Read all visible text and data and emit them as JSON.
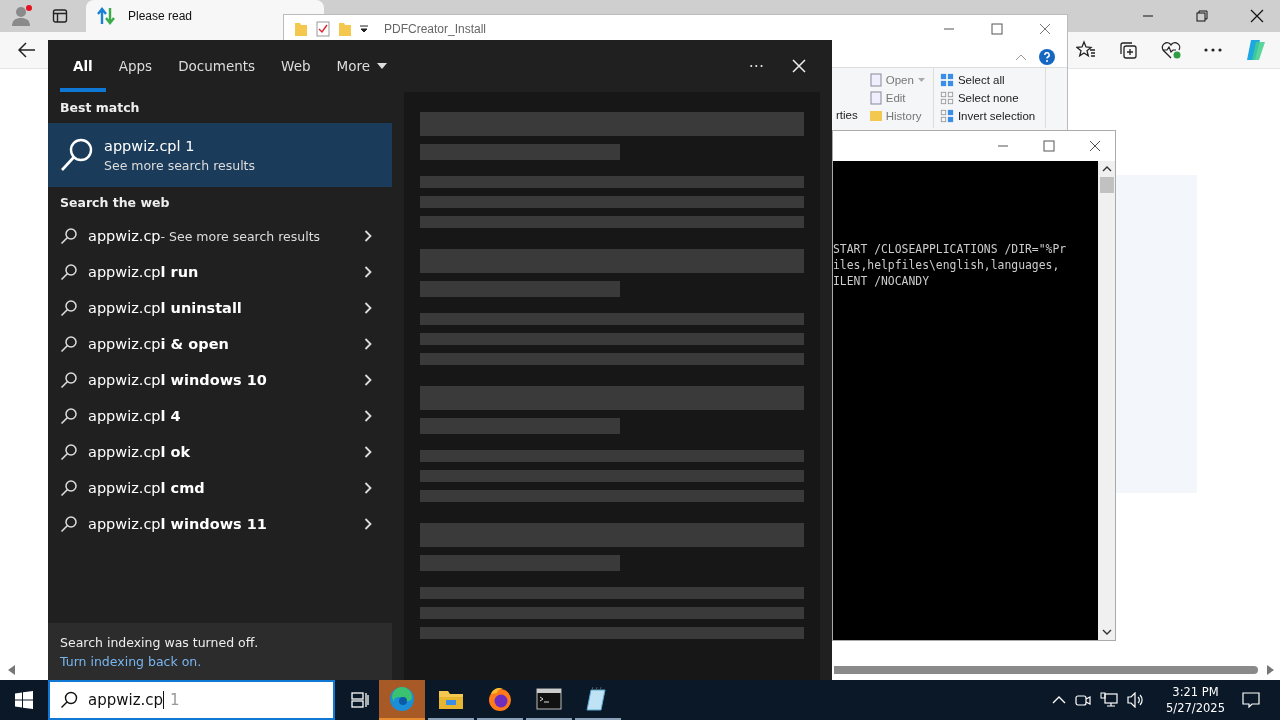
{
  "browser": {
    "tab_title": "Please read"
  },
  "explorer": {
    "title": "PDFCreator_Install",
    "ribbon": {
      "properties_partial": "rties",
      "open": "Open",
      "edit": "Edit",
      "history": "History",
      "select_all": "Select all",
      "select_none": "Select none",
      "invert_selection": "Invert selection"
    }
  },
  "console": {
    "lines": [
      "START /CLOSEAPPLICATIONS /DIR=\"%Pr",
      "iles,helpfiles\\english,languages,",
      "ILENT /NOCANDY"
    ]
  },
  "search": {
    "tabs": [
      {
        "label": "All",
        "selected": true
      },
      {
        "label": "Apps",
        "selected": false
      },
      {
        "label": "Documents",
        "selected": false
      },
      {
        "label": "Web",
        "selected": false
      },
      {
        "label": "More",
        "selected": false
      }
    ],
    "more_options": "···",
    "best_match_heading": "Best match",
    "best_match": {
      "title": "appwiz.cpl 1",
      "subtitle": "See more search results"
    },
    "web_heading": "Search the web",
    "web_results": [
      {
        "text": "appwiz.cp",
        "hint": "- See more search results"
      },
      {
        "text": "appwiz.cp**l run**"
      },
      {
        "text": "appwiz.cp**l uninstall**"
      },
      {
        "text": "appwiz.cp**i & open**"
      },
      {
        "text": "appwiz.cp**l windows 10**"
      },
      {
        "text": "appwiz.cp**l 4**"
      },
      {
        "text": "appwiz.cp**l ok**"
      },
      {
        "text": "appwiz.cp**l cmd**"
      },
      {
        "text": "appwiz.cp**l windows 11**"
      }
    ],
    "indexing_notice": "Search indexing was turned off.",
    "indexing_link": "Turn indexing back on."
  },
  "taskbar": {
    "search": {
      "value": "appwiz.cp",
      "suggestion": "1"
    },
    "apps": [
      {
        "kind": "edge",
        "flashing": true
      },
      {
        "kind": "explorer",
        "flashing": false
      },
      {
        "kind": "firefox",
        "flashing": false
      },
      {
        "kind": "cmd",
        "flashing": false
      },
      {
        "kind": "notepad",
        "flashing": false
      }
    ],
    "time": "3:21 PM",
    "date": "5/27/2025"
  }
}
